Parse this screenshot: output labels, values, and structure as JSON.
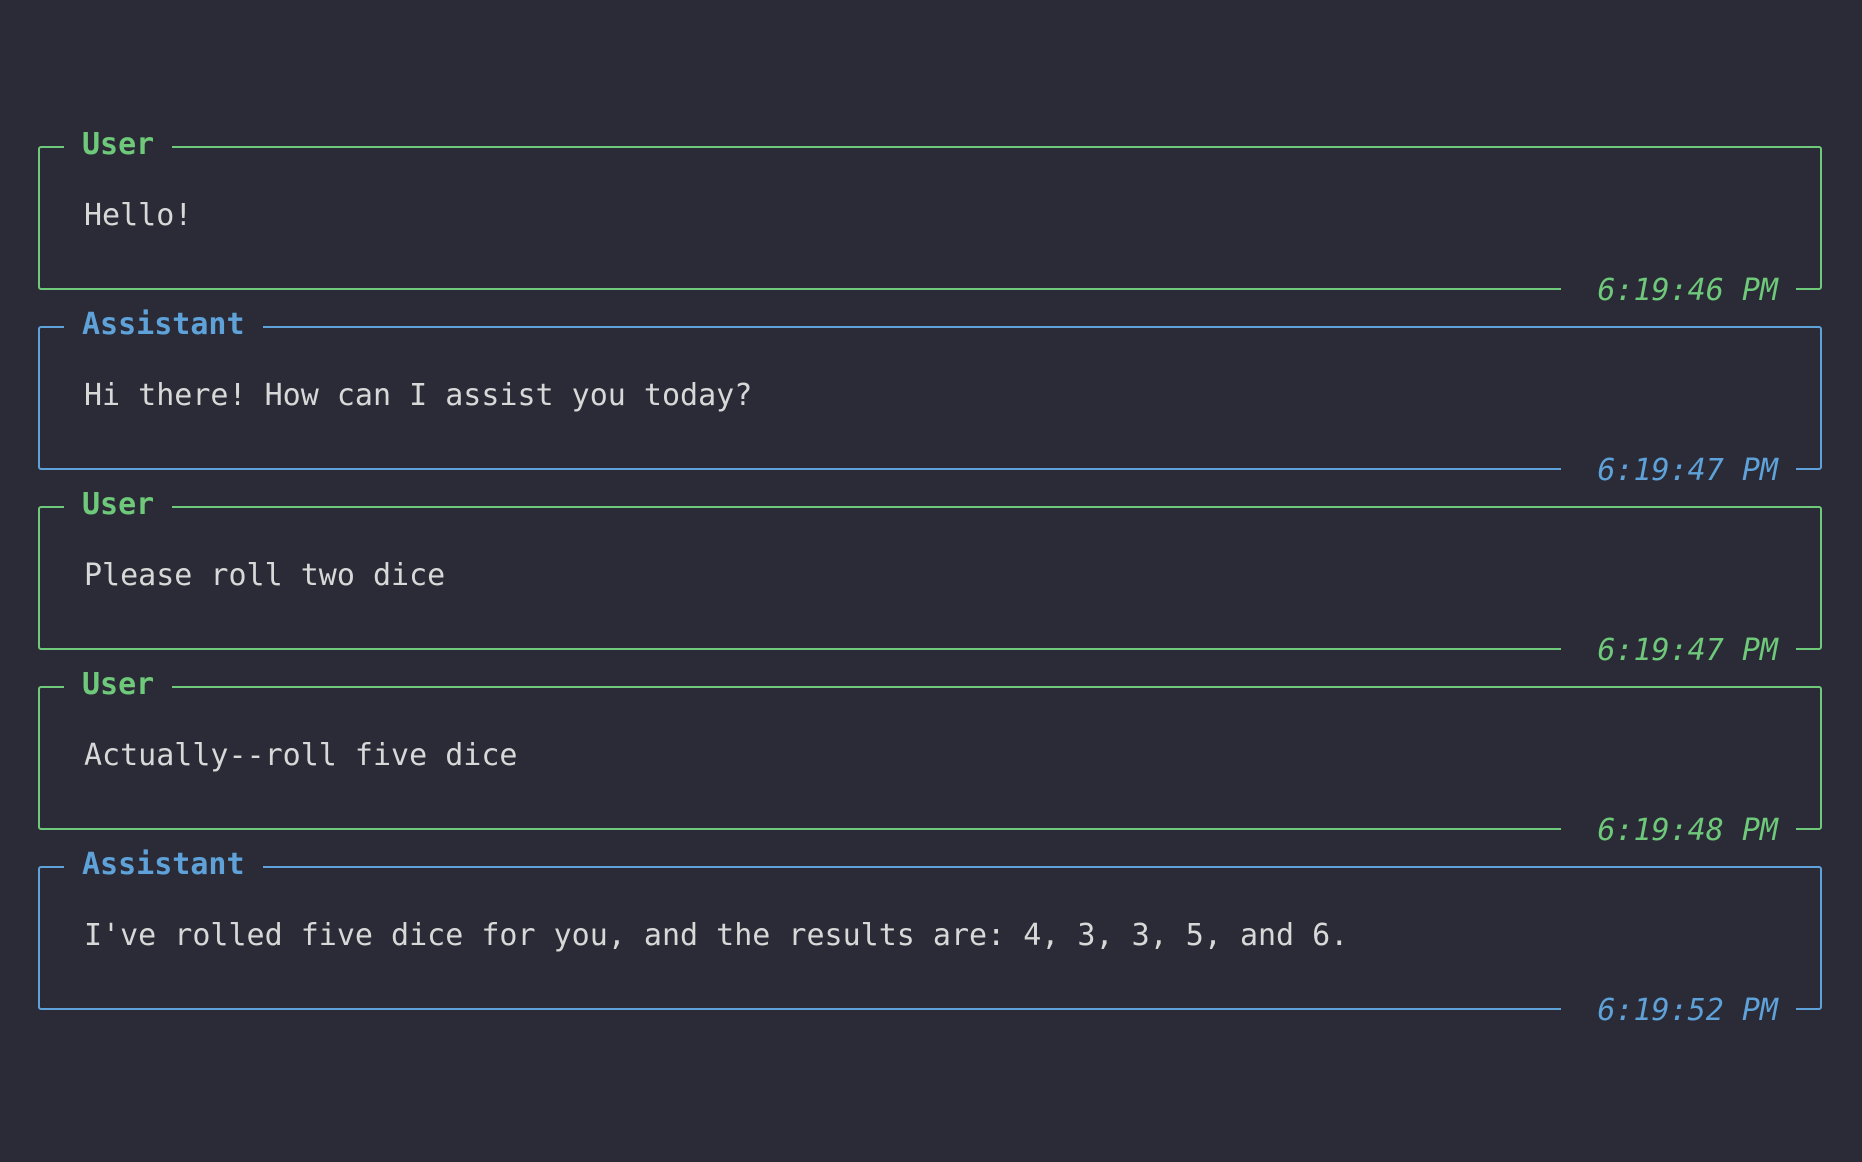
{
  "colors": {
    "background": "#2a2b36",
    "user": "#6fc97a",
    "assistant": "#5ea2d9",
    "text": "#d8d8d8"
  },
  "messages": [
    {
      "role": "User",
      "text": "Hello!",
      "time": "6:19:46 PM"
    },
    {
      "role": "Assistant",
      "text": "Hi there! How can I assist you today?",
      "time": "6:19:47 PM"
    },
    {
      "role": "User",
      "text": "Please roll two dice",
      "time": "6:19:47 PM"
    },
    {
      "role": "User",
      "text": "Actually--roll five dice",
      "time": "6:19:48 PM"
    },
    {
      "role": "Assistant",
      "text": "I've rolled five dice for you, and the results are: 4, 3, 3, 5, and 6.",
      "time": "6:19:52 PM"
    }
  ]
}
